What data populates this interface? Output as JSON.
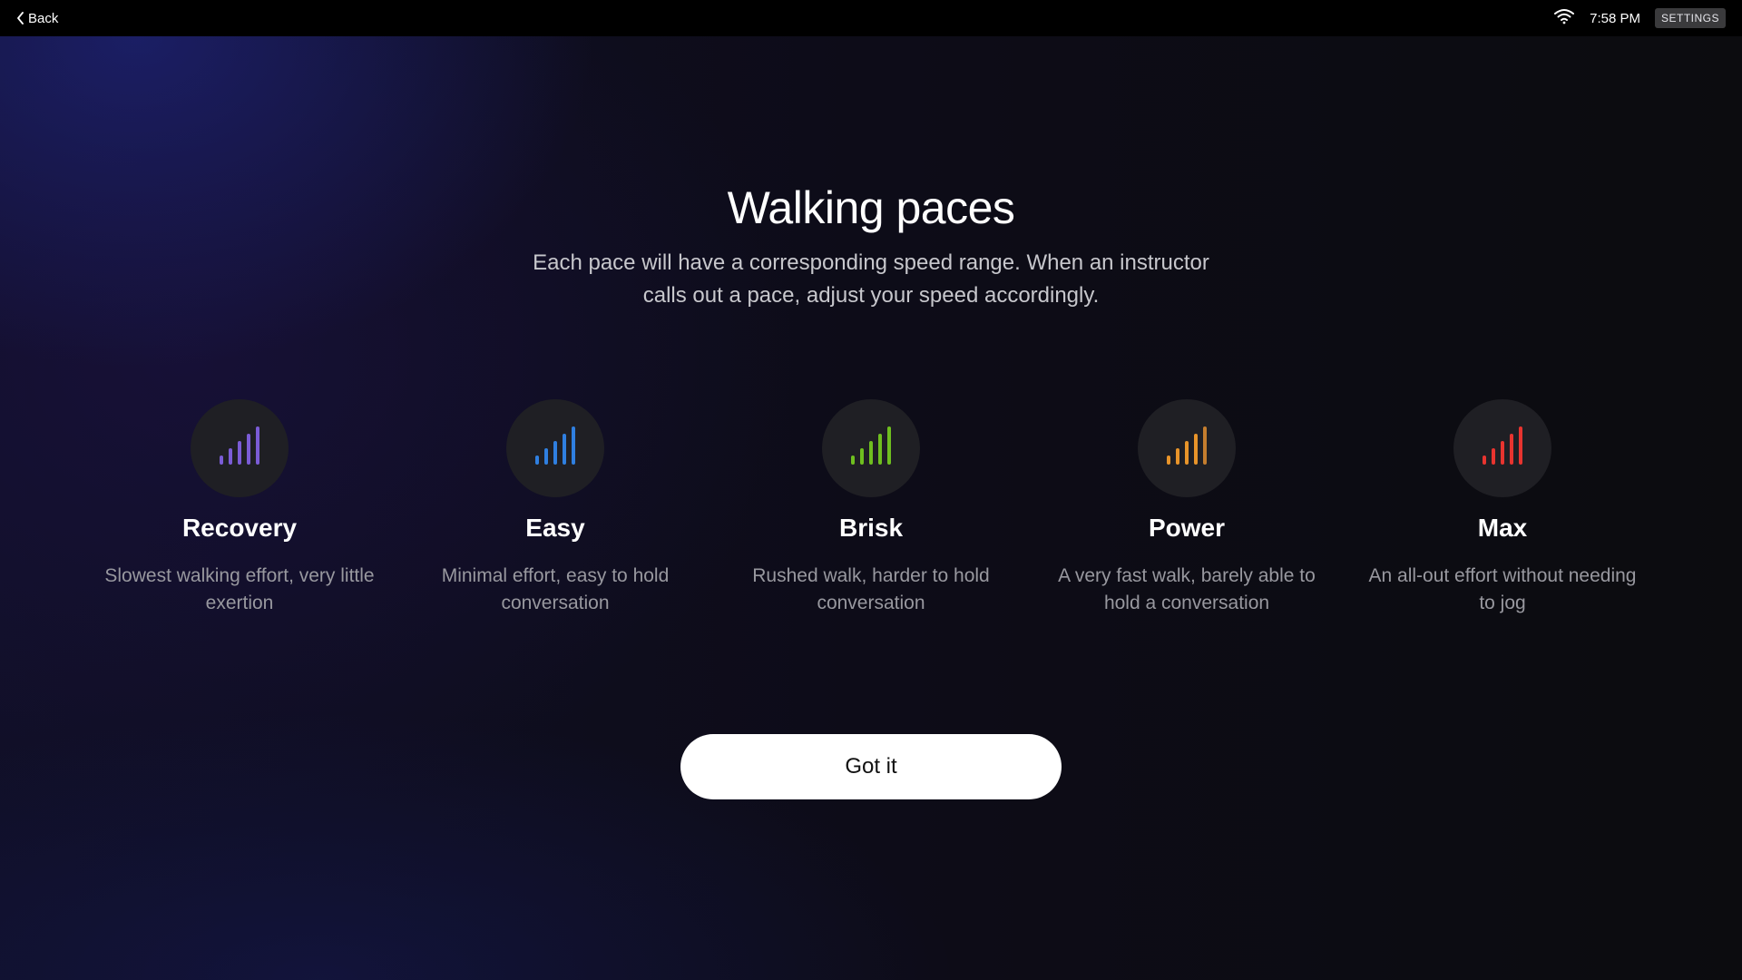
{
  "topbar": {
    "back_label": "Back",
    "time": "7:58 PM",
    "settings_label": "SETTINGS"
  },
  "main": {
    "title": "Walking paces",
    "subtitle": "Each pace will have a corresponding speed range. When an instructor calls out a pace, adjust your speed accordingly.",
    "paces": [
      {
        "name": "Recovery",
        "description": "Slowest walking effort, very little exertion",
        "icon": "signal-bars-icon",
        "color": "#7b5cd6"
      },
      {
        "name": "Easy",
        "description": "Minimal effort, easy to hold conversation",
        "icon": "signal-bars-icon",
        "color": "#2f7fe0"
      },
      {
        "name": "Brisk",
        "description": "Rushed walk, harder to hold conversation",
        "icon": "signal-bars-icon",
        "color": "#6fbf1f"
      },
      {
        "name": "Power",
        "description": "A very fast walk, barely able to hold a conversation",
        "icon": "signal-bars-icon",
        "color": "#e8942a"
      },
      {
        "name": "Max",
        "description": "An all-out effort without needing to jog",
        "icon": "signal-bars-icon",
        "color": "#e8342f"
      }
    ],
    "got_it_label": "Got it"
  }
}
